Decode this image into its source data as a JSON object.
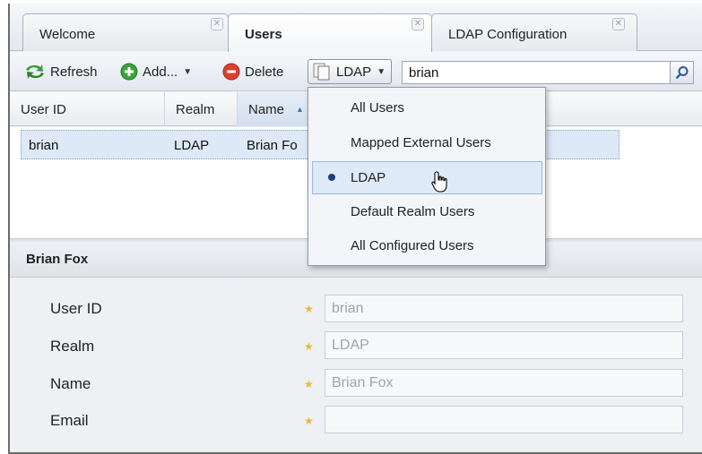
{
  "tabs": [
    {
      "label": "Welcome",
      "active": false
    },
    {
      "label": "Users",
      "active": true
    },
    {
      "label": "LDAP Configuration",
      "active": false
    }
  ],
  "toolbar": {
    "refresh_label": "Refresh",
    "add_label": "Add...",
    "delete_label": "Delete",
    "realm_label": "LDAP",
    "search_value": "brian"
  },
  "grid": {
    "columns": [
      "User ID",
      "Realm",
      "Name"
    ],
    "sort_column": "Name",
    "sort_direction": "ascending",
    "rows": [
      {
        "user_id": "brian",
        "realm": "LDAP",
        "name": "Brian Fo"
      }
    ]
  },
  "realm_menu": {
    "items": [
      "All Users",
      "Mapped External Users",
      "LDAP",
      "Default Realm Users",
      "All Configured Users"
    ],
    "selected": "LDAP"
  },
  "detail": {
    "title": "Brian Fox",
    "fields": [
      {
        "label": "User ID",
        "value": "brian"
      },
      {
        "label": "Realm",
        "value": "LDAP"
      },
      {
        "label": "Name",
        "value": "Brian Fox"
      },
      {
        "label": "Email",
        "value": ""
      }
    ]
  },
  "colors": {
    "accent": "#1e3f70",
    "selection": "#dde9f7",
    "required_star": "#e8b935",
    "refresh_icon": "#3c9a3a",
    "add_icon": "#3aa53a",
    "delete_icon": "#d9402e"
  },
  "icons": {
    "refresh": "refresh-icon",
    "add": "add-icon",
    "delete": "delete-icon",
    "realm": "copy-icon",
    "search": "search-icon",
    "close": "close-icon",
    "required": "star-icon",
    "cursor": "hand-cursor-icon"
  }
}
